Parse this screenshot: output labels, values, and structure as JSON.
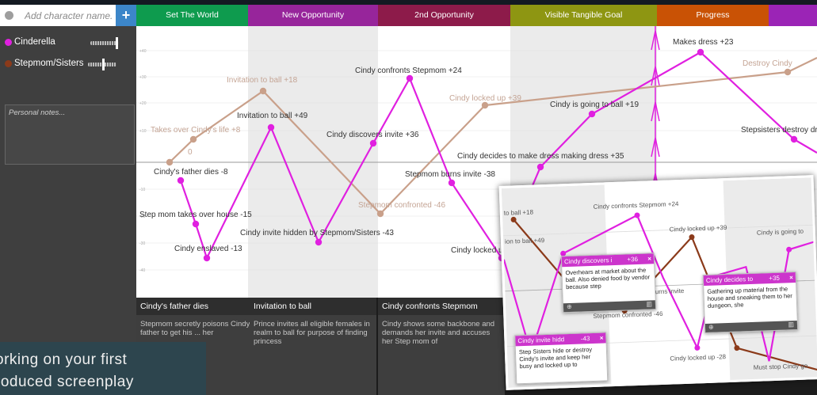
{
  "sidebar": {
    "add_placeholder": "Add character name...",
    "add_button": "+",
    "characters": [
      {
        "name": "Cinderella",
        "color": "#e020e0",
        "weight": 0.85
      },
      {
        "name": "Stepmom/Sisters",
        "color": "#8b3a1a",
        "weight": 0.6
      }
    ],
    "notes_placeholder": "Personal notes..."
  },
  "header": {
    "columns": [
      {
        "label": "Set The World",
        "color": "#0e9b4e"
      },
      {
        "label": "New Opportunity",
        "color": "#97259b"
      },
      {
        "label": "2nd Opportunity",
        "color": "#8d1b4a"
      },
      {
        "label": "Visible Tangible Goal",
        "color": "#8e9612"
      },
      {
        "label": "Progress",
        "color": "#c95205"
      },
      {
        "label": "",
        "color": "#9b24b6"
      }
    ]
  },
  "chart_data": {
    "type": "line",
    "y_tick_labels": [
      "+40",
      "+30",
      "+20",
      "+10",
      "-10",
      "-20",
      "-30",
      "-40"
    ],
    "series": [
      {
        "name": "Cinderella",
        "color": "#e020e0",
        "points": [
          {
            "label": "Cindy's father dies -8",
            "value": -8
          },
          {
            "label": "Step mom takes over house -15",
            "value": -15
          },
          {
            "label": "Cindy enslaved -13",
            "value": -13
          },
          {
            "label": "Invitation to ball +49",
            "value": 49
          },
          {
            "label": "Cindy invite hidden by Stepmom/Sisters -43",
            "value": -43
          },
          {
            "label": "Cindy discovers invite +36",
            "value": 36
          },
          {
            "label": "Cindy confronts Stepmom +24",
            "value": 24
          },
          {
            "label": "Stepmom burns invite -38",
            "value": -38
          },
          {
            "label": "Cindy locked up -28",
            "value": -28
          },
          {
            "label": "Cindy decides to make dress making dress +35",
            "value": 35
          },
          {
            "label": "Cindy is going to ball +19",
            "value": 19
          },
          {
            "label": "Makes dress +23",
            "value": 23
          },
          {
            "label": "Stepsisters destroy dress",
            "value": null
          }
        ]
      },
      {
        "name": "Stepmom/Sisters",
        "color": "#8b3a1a",
        "points": [
          {
            "label": "0",
            "value": 0
          },
          {
            "label": "Takes over Cindy's life +8",
            "value": 8
          },
          {
            "label": "Invitation to ball +18",
            "value": 18
          },
          {
            "label": "Stepmom confronted -46",
            "value": -46
          },
          {
            "label": "Cindy locked up +39",
            "value": 39
          },
          {
            "label": "Destroy Cindy",
            "value": null
          }
        ]
      }
    ]
  },
  "cards": [
    {
      "title": "Cindy's father dies",
      "body": "Stepmom secretly poisons Cindy's father to get his ... her"
    },
    {
      "title": "Invitation to ball",
      "body": "Prince invites all eligible females in realm to ball for purpose of finding princess"
    },
    {
      "title": "Cindy confronts Stepmom",
      "body": "Cindy shows some backbone and demands her invite and accuses her Step mom of"
    }
  ],
  "banner": {
    "line1": "orking on your first",
    "line2": "roduced screenplay"
  },
  "inset": {
    "labels": [
      {
        "text": "to ball +18"
      },
      {
        "text": "Cindy confronts Stepmom +24"
      },
      {
        "text": "ion to ball +49"
      },
      {
        "text": "Cindy locked up +39"
      },
      {
        "text": "Cindy is going to"
      },
      {
        "text": "burns invite"
      },
      {
        "text": "Stepmom confronted -46"
      },
      {
        "text": "Cindy locked up -28"
      },
      {
        "text": "Must stop Cindy go"
      }
    ],
    "cards": [
      {
        "title": "Cindy discovers i",
        "score": "+36",
        "close": "×",
        "body": "Overhears at market about the ball. Also denied food by vendor because step"
      },
      {
        "title": "Cindy decides to",
        "score": "+35",
        "close": "×",
        "body": "Gathering up material from the house and sneaking them to her dungeon, she"
      },
      {
        "title": "Cindy invite hidd",
        "score": "-43",
        "close": "×",
        "body": "Step Sisters hide or destroy Cindy's invite and keep her busy and locked up to"
      }
    ]
  }
}
